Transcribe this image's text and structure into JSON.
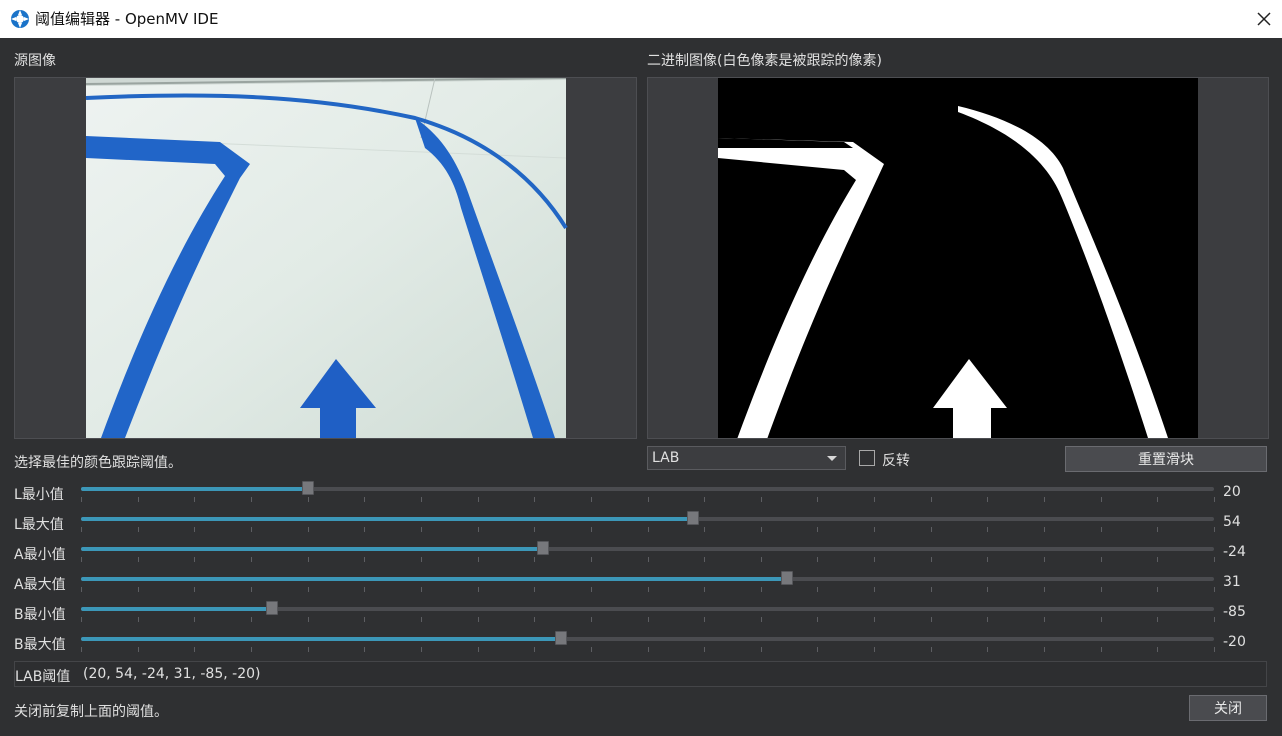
{
  "window": {
    "title": "阈值编辑器 - OpenMV IDE",
    "app_icon": "openmv-icon",
    "close_icon": "close-icon"
  },
  "source": {
    "label": "源图像"
  },
  "binary": {
    "label": "二进制图像(白色像素是被跟踪的像素)"
  },
  "hint": "选择最佳的颜色跟踪阈值。",
  "colorspace": {
    "selected": "LAB"
  },
  "invert": {
    "label": "反转",
    "checked": false
  },
  "reset_button": "重置滑块",
  "sliders": [
    {
      "label": "L最小值",
      "value": "20",
      "min": 0,
      "max": 100,
      "num": 20
    },
    {
      "label": "L最大值",
      "value": "54",
      "min": 0,
      "max": 100,
      "num": 54
    },
    {
      "label": "A最小值",
      "value": "-24",
      "min": -128,
      "max": 127,
      "num": -24
    },
    {
      "label": "A最大值",
      "value": "31",
      "min": -128,
      "max": 127,
      "num": 31
    },
    {
      "label": "B最小值",
      "value": "-85",
      "min": -128,
      "max": 127,
      "num": -85
    },
    {
      "label": "B最大值",
      "value": "-20",
      "min": -128,
      "max": 127,
      "num": -20
    }
  ],
  "result": {
    "label": "LAB阈值",
    "value": "(20, 54, -24, 31, -85, -20)"
  },
  "footer": {
    "hint": "关闭前复制上面的阈值。",
    "close_button": "关闭"
  },
  "colors": {
    "accent": "#3c97b8",
    "background": "#2f3032",
    "track_blue": "#1f63c6",
    "floor": "#dfe8e4"
  }
}
